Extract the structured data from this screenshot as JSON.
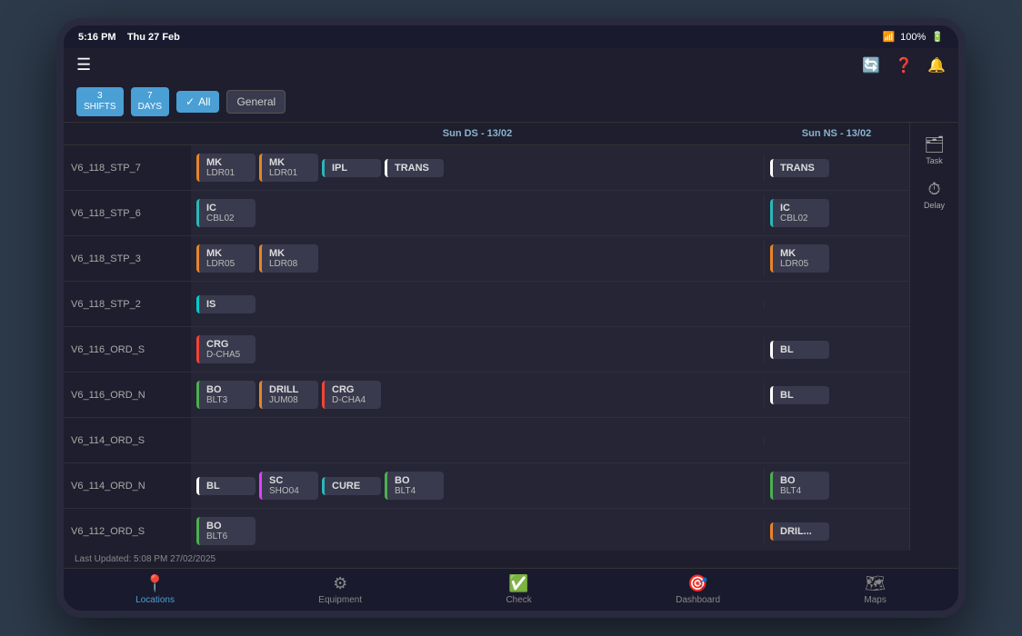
{
  "statusBar": {
    "time": "5:16 PM",
    "date": "Thu 27 Feb",
    "battery": "100%",
    "wifiIcon": "📶"
  },
  "toolbar": {
    "shiftsLabel": "3\nSHIFTS",
    "daysLabel": "7\nDAYS",
    "allLabel": "All",
    "generalLabel": "General"
  },
  "header": {
    "leftDate": "Sun DS - 13/02",
    "rightDate": "Sun NS - 13/02"
  },
  "sidePanel": {
    "taskLabel": "Task",
    "delayLabel": "Delay"
  },
  "rows": [
    {
      "id": "V6_118_STP_7",
      "leftTasks": [
        {
          "line1": "MK",
          "line2": "LDR01",
          "color": "orange"
        },
        {
          "line1": "MK",
          "line2": "LDR01",
          "color": "orange"
        },
        {
          "line1": "IPL",
          "line2": "",
          "color": "teal"
        },
        {
          "line1": "TRANS",
          "line2": "",
          "color": "white"
        }
      ],
      "rightTasks": [
        {
          "line1": "TRANS",
          "line2": "",
          "color": "white"
        }
      ]
    },
    {
      "id": "V6_118_STP_6",
      "leftTasks": [
        {
          "line1": "IC",
          "line2": "CBL02",
          "color": "teal"
        }
      ],
      "rightTasks": [
        {
          "line1": "IC",
          "line2": "CBL02",
          "color": "teal"
        }
      ]
    },
    {
      "id": "V6_118_STP_3",
      "leftTasks": [
        {
          "line1": "MK",
          "line2": "LDR05",
          "color": "orange"
        },
        {
          "line1": "MK",
          "line2": "LDR08",
          "color": "orange"
        }
      ],
      "rightTasks": [
        {
          "line1": "MK",
          "line2": "LDR05",
          "color": "orange"
        }
      ]
    },
    {
      "id": "V6_118_STP_2",
      "leftTasks": [
        {
          "line1": "IS",
          "line2": "",
          "color": "cyan"
        }
      ],
      "rightTasks": []
    },
    {
      "id": "V6_116_ORD_S",
      "leftTasks": [
        {
          "line1": "CRG",
          "line2": "D-CHA5",
          "color": "red"
        }
      ],
      "rightTasks": [
        {
          "line1": "BL",
          "line2": "",
          "color": "white"
        }
      ]
    },
    {
      "id": "V6_116_ORD_N",
      "leftTasks": [
        {
          "line1": "BO",
          "line2": "BLT3",
          "color": "green"
        },
        {
          "line1": "DRILL",
          "line2": "JUM08",
          "color": "orange"
        },
        {
          "line1": "CRG",
          "line2": "D-CHA4",
          "color": "red"
        }
      ],
      "rightTasks": [
        {
          "line1": "BL",
          "line2": "",
          "color": "white"
        }
      ]
    },
    {
      "id": "V6_114_ORD_S",
      "leftTasks": [],
      "rightTasks": []
    },
    {
      "id": "V6_114_ORD_N",
      "leftTasks": [
        {
          "line1": "BL",
          "line2": "",
          "color": "white"
        },
        {
          "line1": "SC",
          "line2": "SHO04",
          "color": "pink"
        },
        {
          "line1": "CURE",
          "line2": "",
          "color": "teal"
        },
        {
          "line1": "BO",
          "line2": "BLT4",
          "color": "green"
        }
      ],
      "rightTasks": [
        {
          "line1": "BO",
          "line2": "BLT4",
          "color": "green"
        }
      ]
    },
    {
      "id": "V6_112_ORD_S",
      "leftTasks": [
        {
          "line1": "BO",
          "line2": "BLT6",
          "color": "green"
        }
      ],
      "rightTasks": [
        {
          "line1": "DRIL...",
          "line2": "",
          "color": "orange"
        }
      ]
    }
  ],
  "footer": {
    "lastUpdated": "Last Updated: 5:08 PM 27/02/2025"
  },
  "bottomNav": [
    {
      "label": "Locations",
      "icon": "📍",
      "active": true
    },
    {
      "label": "Equipment",
      "icon": "👁"
    },
    {
      "label": "Check",
      "icon": "✅"
    },
    {
      "label": "Dashboard",
      "icon": "🎯"
    },
    {
      "label": "Maps",
      "icon": "🗺"
    }
  ]
}
